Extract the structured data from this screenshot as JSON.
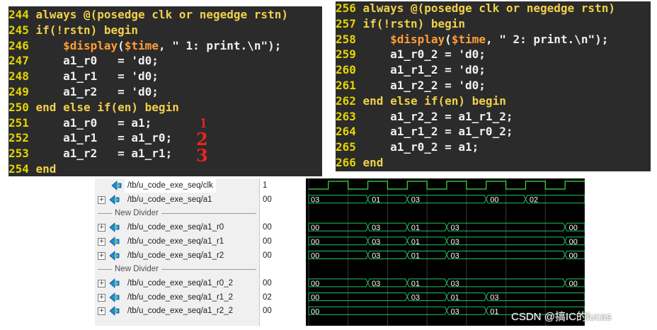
{
  "code_left": {
    "lines": [
      {
        "num": "244",
        "parts": [
          {
            "t": " always @(posedge clk or negedge rstn)",
            "c": "kw"
          }
        ]
      },
      {
        "num": "245",
        "parts": [
          {
            "t": " if(!rstn) begin",
            "c": "kw"
          }
        ]
      },
      {
        "num": "246",
        "parts": [
          {
            "t": "     $display($time, \" 1: print.\\n\");",
            "c": "sys"
          }
        ]
      },
      {
        "num": "247",
        "parts": [
          {
            "t": "     a1_r0   = 'd0;",
            "c": "plain"
          }
        ]
      },
      {
        "num": "248",
        "parts": [
          {
            "t": "     a1_r1   = 'd0;",
            "c": "plain"
          }
        ]
      },
      {
        "num": "249",
        "parts": [
          {
            "t": "     a1_r2   = 'd0;",
            "c": "plain"
          }
        ]
      },
      {
        "num": "250",
        "parts": [
          {
            "t": " end else if(en) begin",
            "c": "kw"
          }
        ]
      },
      {
        "num": "251",
        "parts": [
          {
            "t": "     a1_r0   = a1;",
            "c": "plain"
          }
        ]
      },
      {
        "num": "252",
        "parts": [
          {
            "t": "     a1_r1   = a1_r0;",
            "c": "plain"
          }
        ]
      },
      {
        "num": "253",
        "parts": [
          {
            "t": "     a1_r2   = a1_r1;",
            "c": "plain"
          }
        ]
      },
      {
        "num": "254",
        "parts": [
          {
            "t": " end",
            "c": "kw"
          }
        ]
      }
    ],
    "annotations": [
      "1",
      "2",
      "3"
    ]
  },
  "code_right": {
    "lines": [
      {
        "num": "256",
        "parts": [
          {
            "t": " always @(posedge clk or negedge rstn)",
            "c": "kw"
          }
        ]
      },
      {
        "num": "257",
        "parts": [
          {
            "t": " if(!rstn) begin",
            "c": "kw"
          }
        ]
      },
      {
        "num": "258",
        "parts": [
          {
            "t": "     $display($time, \" 2: print.\\n\");",
            "c": "sys"
          }
        ]
      },
      {
        "num": "259",
        "parts": [
          {
            "t": "     a1_r0_2 = 'd0;",
            "c": "plain"
          }
        ]
      },
      {
        "num": "260",
        "parts": [
          {
            "t": "     a1_r1_2 = 'd0;",
            "c": "plain"
          }
        ]
      },
      {
        "num": "261",
        "parts": [
          {
            "t": "     a1_r2_2 = 'd0;",
            "c": "plain"
          }
        ]
      },
      {
        "num": "262",
        "parts": [
          {
            "t": " end else if(en) begin",
            "c": "kw"
          }
        ]
      },
      {
        "num": "263",
        "parts": [
          {
            "t": "     a1_r2_2 = a1_r1_2;",
            "c": "plain"
          }
        ]
      },
      {
        "num": "264",
        "parts": [
          {
            "t": "     a1_r1_2 = a1_r0_2;",
            "c": "plain"
          }
        ]
      },
      {
        "num": "265",
        "parts": [
          {
            "t": "     a1_r0_2 = a1;",
            "c": "plain"
          }
        ]
      },
      {
        "num": "266",
        "parts": [
          {
            "t": " end",
            "c": "kw"
          }
        ]
      }
    ]
  },
  "waveform": {
    "rows": [
      {
        "type": "signal",
        "name": "/tb/u_code_exe_seq/clk",
        "value": "1",
        "expandable": false,
        "selected": true
      },
      {
        "type": "signal",
        "name": "/tb/u_code_exe_seq/a1",
        "value": "00",
        "expandable": true
      },
      {
        "type": "divider",
        "name": "New Divider"
      },
      {
        "type": "signal",
        "name": "/tb/u_code_exe_seq/a1_r0",
        "value": "00",
        "expandable": true
      },
      {
        "type": "signal",
        "name": "/tb/u_code_exe_seq/a1_r1",
        "value": "00",
        "expandable": true
      },
      {
        "type": "signal",
        "name": "/tb/u_code_exe_seq/a1_r2",
        "value": "00",
        "expandable": true
      },
      {
        "type": "divider",
        "name": "New Divider"
      },
      {
        "type": "signal",
        "name": "/tb/u_code_exe_seq/a1_r0_2",
        "value": "00",
        "expandable": true
      },
      {
        "type": "signal",
        "name": "/tb/u_code_exe_seq/a1_r1_2",
        "value": "02",
        "expandable": true
      },
      {
        "type": "signal",
        "name": "/tb/u_code_exe_seq/a1_r2_2",
        "value": "00",
        "expandable": true
      }
    ],
    "clock": {
      "period": 1,
      "cycles": 7
    },
    "buses": [
      {
        "row": 1,
        "segments": [
          {
            "t0": 0,
            "label": "03"
          },
          {
            "t0": 1.5,
            "label": "01"
          },
          {
            "t0": 2.5,
            "label": "03"
          },
          {
            "t0": 4.5,
            "label": "00"
          },
          {
            "t0": 5.5,
            "label": "02"
          }
        ]
      },
      {
        "row": 3,
        "segments": [
          {
            "t0": 0,
            "label": "00"
          },
          {
            "t0": 1.5,
            "label": "03"
          },
          {
            "t0": 2.5,
            "label": "01"
          },
          {
            "t0": 3.5,
            "label": "03"
          },
          {
            "t0": 6.5,
            "label": "00"
          }
        ]
      },
      {
        "row": 4,
        "segments": [
          {
            "t0": 0,
            "label": "00"
          },
          {
            "t0": 1.5,
            "label": "03"
          },
          {
            "t0": 2.5,
            "label": "01"
          },
          {
            "t0": 3.5,
            "label": "03"
          },
          {
            "t0": 6.5,
            "label": "00"
          }
        ]
      },
      {
        "row": 5,
        "segments": [
          {
            "t0": 0,
            "label": "00"
          },
          {
            "t0": 1.5,
            "label": "03"
          },
          {
            "t0": 2.5,
            "label": "01"
          },
          {
            "t0": 3.5,
            "label": "03"
          },
          {
            "t0": 6.5,
            "label": "00"
          }
        ]
      },
      {
        "row": 7,
        "segments": [
          {
            "t0": 0,
            "label": "00"
          },
          {
            "t0": 1.5,
            "label": "03"
          },
          {
            "t0": 2.5,
            "label": "01"
          },
          {
            "t0": 3.5,
            "label": "03"
          },
          {
            "t0": 6.5,
            "label": "00"
          }
        ]
      },
      {
        "row": 8,
        "segments": [
          {
            "t0": 0,
            "label": "00"
          },
          {
            "t0": 2.5,
            "label": "03"
          },
          {
            "t0": 3.5,
            "label": "01"
          },
          {
            "t0": 4.5,
            "label": "03"
          }
        ]
      },
      {
        "row": 9,
        "segments": [
          {
            "t0": 0,
            "label": "00"
          },
          {
            "t0": 3.5,
            "label": "03"
          },
          {
            "t0": 4.5,
            "label": "01"
          }
        ]
      }
    ],
    "colors": {
      "wave": "#22c55e",
      "clock": "#3fe03f",
      "background": "#000000"
    }
  },
  "watermark": "CSDN @搞IC的lucas"
}
